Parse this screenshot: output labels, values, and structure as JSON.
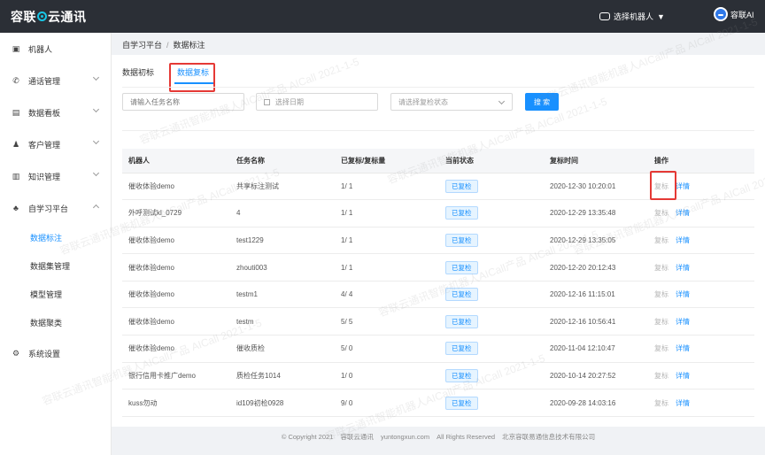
{
  "header": {
    "brand_left": "容联",
    "brand_right": "云通讯",
    "robot_selector": "选择机器人",
    "user_name": "容联AI"
  },
  "sidebar": {
    "items": [
      {
        "label": "机器人",
        "icon": "robot-icon"
      },
      {
        "label": "通话管理",
        "icon": "phone-icon"
      },
      {
        "label": "数据看板",
        "icon": "dashboard-icon"
      },
      {
        "label": "客户管理",
        "icon": "customers-icon"
      },
      {
        "label": "知识管理",
        "icon": "knowledge-icon"
      },
      {
        "label": "自学习平台",
        "icon": "users-icon"
      },
      {
        "label": "系统设置",
        "icon": "settings-icon"
      }
    ],
    "sub_items": [
      "数据标注",
      "数据集管理",
      "模型管理",
      "数据聚类"
    ]
  },
  "breadcrumb": {
    "root": "自学习平台",
    "sep": "/",
    "current": "数据标注"
  },
  "tabs": [
    "数据初标",
    "数据复标"
  ],
  "filters": {
    "task_placeholder": "请输入任务名称",
    "date_placeholder": "选择日期",
    "status_placeholder": "请选择复检状态",
    "search_label": "搜 索"
  },
  "table": {
    "columns": [
      "机器人",
      "任务名称",
      "已复标/复标量",
      "当前状态",
      "复标时间",
      "操作"
    ],
    "rows": [
      {
        "robot": "催收体验demo",
        "task": "共享标注测试",
        "count": "1/ 1",
        "status": "已复检",
        "time": "2020-12-30 10:20:01",
        "op1": "复标",
        "op2": "详情"
      },
      {
        "robot": "外呼测试kl_0729",
        "task": "4",
        "count": "1/ 1",
        "status": "已复检",
        "time": "2020-12-29 13:35:48",
        "op1": "复标",
        "op2": "详情"
      },
      {
        "robot": "催收体验demo",
        "task": "test1229",
        "count": "1/ 1",
        "status": "已复检",
        "time": "2020-12-29 13:35:05",
        "op1": "复标",
        "op2": "详情"
      },
      {
        "robot": "催收体验demo",
        "task": "zhouti003",
        "count": "1/ 1",
        "status": "已复检",
        "time": "2020-12-20 20:12:43",
        "op1": "复标",
        "op2": "详情"
      },
      {
        "robot": "催收体验demo",
        "task": "testm1",
        "count": "4/ 4",
        "status": "已复检",
        "time": "2020-12-16 11:15:01",
        "op1": "复标",
        "op2": "详情"
      },
      {
        "robot": "催收体验demo",
        "task": "testm",
        "count": "5/ 5",
        "status": "已复检",
        "time": "2020-12-16 10:56:41",
        "op1": "复标",
        "op2": "详情"
      },
      {
        "robot": "催收体验demo",
        "task": "催收质检",
        "count": "5/ 0",
        "status": "已复检",
        "time": "2020-11-04 12:10:47",
        "op1": "复标",
        "op2": "详情"
      },
      {
        "robot": "银行信用卡推广demo",
        "task": "质检任务1014",
        "count": "1/ 0",
        "status": "已复检",
        "time": "2020-10-14 20:27:52",
        "op1": "复标",
        "op2": "详情"
      },
      {
        "robot": "kuss勿动",
        "task": "id109初检0928",
        "count": "9/ 0",
        "status": "已复检",
        "time": "2020-09-28 14:03:16",
        "op1": "复标",
        "op2": "详情"
      }
    ]
  },
  "footer": {
    "copyright": "© Copyright 2021",
    "brand": "容联云通讯",
    "domain": "yuntongxun.com",
    "rights": "All Rights Reserved",
    "company": "北京容联易通信息技术有限公司"
  },
  "watermark": "容联云通讯智能机器人AICall产品  AICall  2021-1-5",
  "colors": {
    "accent": "#1890ff",
    "highlight": "#e53935",
    "topbar": "#2b2f36"
  }
}
